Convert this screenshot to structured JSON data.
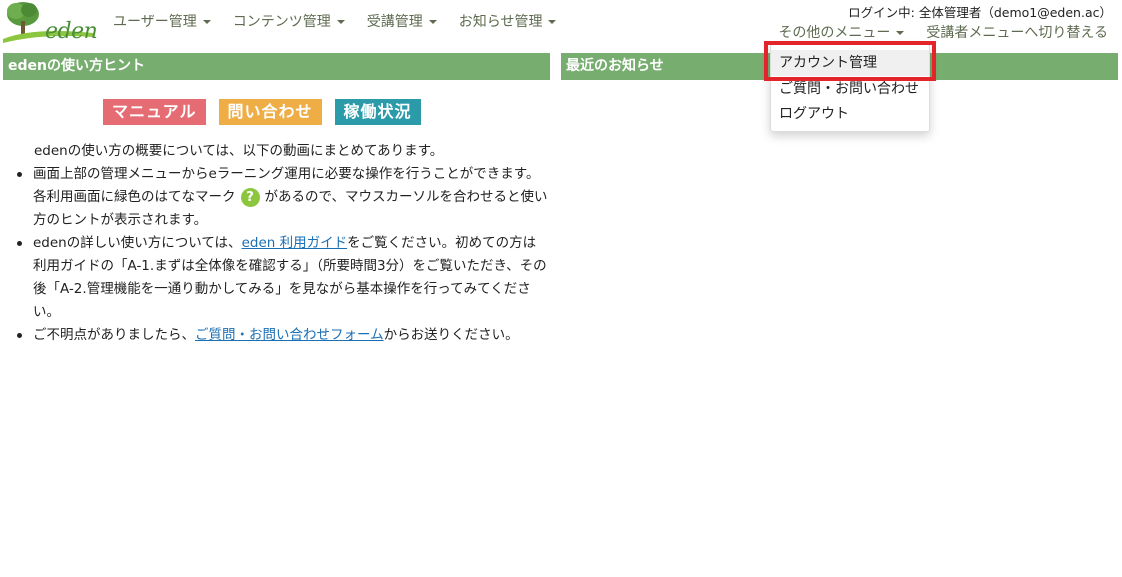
{
  "header": {
    "logo_text": "eden",
    "nav": [
      {
        "label": "ユーザー管理"
      },
      {
        "label": "コンテンツ管理"
      },
      {
        "label": "受講管理"
      },
      {
        "label": "お知らせ管理"
      }
    ],
    "login_info": "ログイン中: 全体管理者（demo1@eden.ac）",
    "other_menu_label": "その他のメニュー",
    "switch_menu_label": "受講者メニューへ切り替える"
  },
  "dropdown": {
    "items": [
      {
        "label": "アカウント管理"
      },
      {
        "label": "ご質問・お問い合わせ"
      },
      {
        "label": "ログアウト"
      }
    ],
    "highlight_color": "#e3242b"
  },
  "hints_panel": {
    "title": "edenの使い方ヒント",
    "buttons": {
      "manual": "マニュアル",
      "contact": "問い合わせ",
      "status": "稼働状況"
    },
    "intro": "edenの使い方の概要については、以下の動画にまとめてあります。",
    "item1_before": "画面上部の管理メニューからeラーニング運用に必要な操作を行うことができます。各利用画面に緑色のはてなマーク",
    "hint_icon_char": "?",
    "item1_after": "があるので、マウスカーソルを合わせると使い方のヒントが表示されます。",
    "item2_before": "edenの詳しい使い方については、",
    "item2_link": "eden 利用ガイド",
    "item2_after": "をご覧ください。初めての方は利用ガイドの「A-1.まずは全体像を確認する」（所要時間3分）をご覧いただき、その後「A-2.管理機能を一通り動かしてみる」を見ながら基本操作を行ってみてください。",
    "item3_before": "ご不明点がありましたら、",
    "item3_link": "ご質問・お問い合わせフォーム",
    "item3_after": "からお送りください。"
  },
  "news_panel": {
    "title": "最近のお知らせ"
  },
  "colors": {
    "panel_header": "#78ad70",
    "btn_manual": "#e46c72",
    "btn_contact": "#efad46",
    "btn_status": "#2b9ba9",
    "link": "#1a6fb5"
  },
  "icons": {
    "logo": "tree-logo-icon",
    "caret": "caret-down-icon",
    "hint": "question-mark-icon"
  }
}
